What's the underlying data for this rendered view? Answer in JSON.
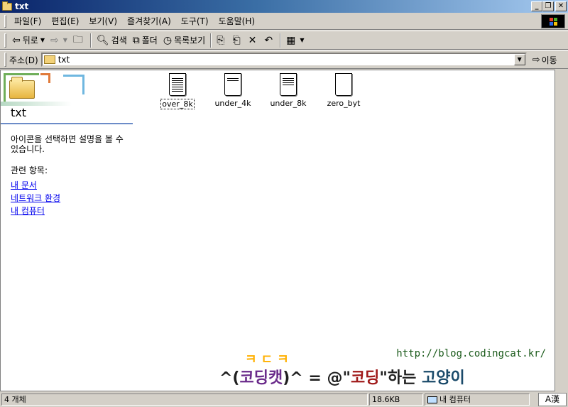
{
  "window": {
    "title": "txt"
  },
  "menu": {
    "items": [
      "파일(F)",
      "편집(E)",
      "보기(V)",
      "즐겨찾기(A)",
      "도구(T)",
      "도움말(H)"
    ]
  },
  "toolbar": {
    "back_label": "뒤로",
    "search_label": "검색",
    "folders_label": "폴더",
    "history_label": "목록보기"
  },
  "address": {
    "label": "주소(D)",
    "value": "txt",
    "go_label": "이동"
  },
  "sidebar": {
    "title": "txt",
    "description": "아이콘을 선택하면 설명을 볼 수 있습니다.",
    "related_label": "관련 항목:",
    "links": [
      "내 문서",
      "네트워크 환경",
      "내 컴퓨터"
    ]
  },
  "files": [
    {
      "name": "over_8k",
      "icon": "text-file-icon",
      "selected": true
    },
    {
      "name": "under_4k",
      "icon": "text-file-icon",
      "selected": false
    },
    {
      "name": "under_8k",
      "icon": "text-file-icon",
      "selected": false
    },
    {
      "name": "zero_byt",
      "icon": "text-file-icon",
      "selected": false
    }
  ],
  "watermark": {
    "url": "http://blog.codingcat.kr/",
    "jamo": "ㅋㄷㅋ",
    "line_a": "^(",
    "line_b": "코딩캣",
    "line_c": ")^ = @\"",
    "line_d": "코딩",
    "line_e": "\"하는 ",
    "line_f": "고양이"
  },
  "status": {
    "count": "4 개체",
    "size": "18.6KB",
    "location": "내 컴퓨터",
    "ime": "A漢"
  },
  "colors": {
    "title_start": "#0a246a",
    "title_end": "#a6caf0",
    "face": "#d4d0c8",
    "link": "#0000ee"
  }
}
